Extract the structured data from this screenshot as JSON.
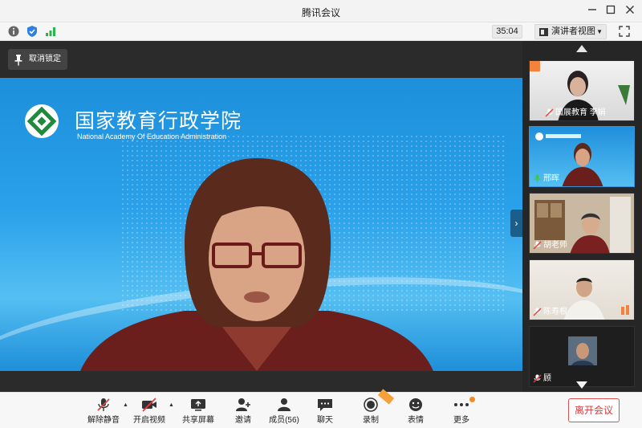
{
  "window": {
    "title": "腾讯会议"
  },
  "toolbar": {
    "timer": "35:04",
    "view_mode": "演讲者视图"
  },
  "stage": {
    "unlock_label": "取消锁定",
    "slide": {
      "org_name_cn": "国家教育行政学院",
      "org_name_en": "National Academy Of Education Administration"
    }
  },
  "sidebar": {
    "participants": [
      {
        "name": "国展教育  李娟",
        "host": true
      },
      {
        "name": "邢晖",
        "speaking": true
      },
      {
        "name": "胡老师"
      },
      {
        "name": "陈寿根"
      },
      {
        "name": "顾"
      }
    ]
  },
  "bottombar": {
    "items": [
      {
        "label": "解除静音"
      },
      {
        "label": "开启视频"
      },
      {
        "label": "共享屏幕"
      },
      {
        "label": "邀请"
      },
      {
        "label": "成员(56)"
      },
      {
        "label": "聊天"
      },
      {
        "label": "录制"
      },
      {
        "label": "表情"
      },
      {
        "label": "更多"
      }
    ],
    "leave_label": "离开会议"
  },
  "colors": {
    "accent": "#1f8ee0",
    "leave": "#e25151",
    "speaking": "#3ec45b"
  }
}
